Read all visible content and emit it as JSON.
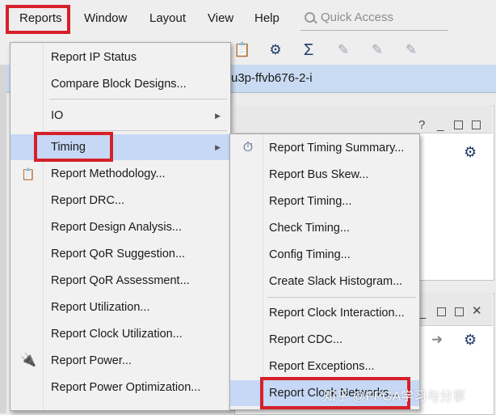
{
  "menubar": {
    "items": [
      "Reports",
      "Window",
      "Layout",
      "View",
      "Help"
    ],
    "quick_access_placeholder": "Quick Access"
  },
  "toolbar": {
    "icons": [
      "clipboard-check-icon",
      "gear-icon",
      "sigma-icon",
      "probe-icon",
      "probe-icon",
      "probe-icon"
    ]
  },
  "project_bar": {
    "part_text": "u3p-ffvb676-2-i"
  },
  "reports_menu": {
    "items": [
      "Report IP Status",
      "Compare Block Designs...",
      "IO",
      "Timing",
      "Report Methodology...",
      "Report DRC...",
      "Report Design Analysis...",
      "Report QoR Suggestion...",
      "Report QoR Assessment...",
      "Report Utilization...",
      "Report Clock Utilization...",
      "Report Power...",
      "Report Power Optimization..."
    ],
    "icons": {
      "report_methodology": "clipboard-check-icon",
      "report_power": "power-plug-icon"
    },
    "highlighted": "Timing"
  },
  "timing_submenu": {
    "items": [
      "Report Timing Summary...",
      "Report Bus Skew...",
      "Report Timing...",
      "Check Timing...",
      "Config Timing...",
      "Create Slack Histogram...",
      "Report Clock Interaction...",
      "Report CDC...",
      "Report Exceptions...",
      "Report Clock Networks..."
    ],
    "icons": {
      "report_timing_summary": "stopwatch-icon"
    }
  },
  "panel_controls": {
    "help": "?",
    "minimize": "_",
    "close": "✕"
  },
  "watermark": "知乎 @FPGA学习与分享",
  "colors": {
    "highlight": "#c6d8f5",
    "callout_red": "#d6202a",
    "project_bar": "#c9dbf3"
  }
}
